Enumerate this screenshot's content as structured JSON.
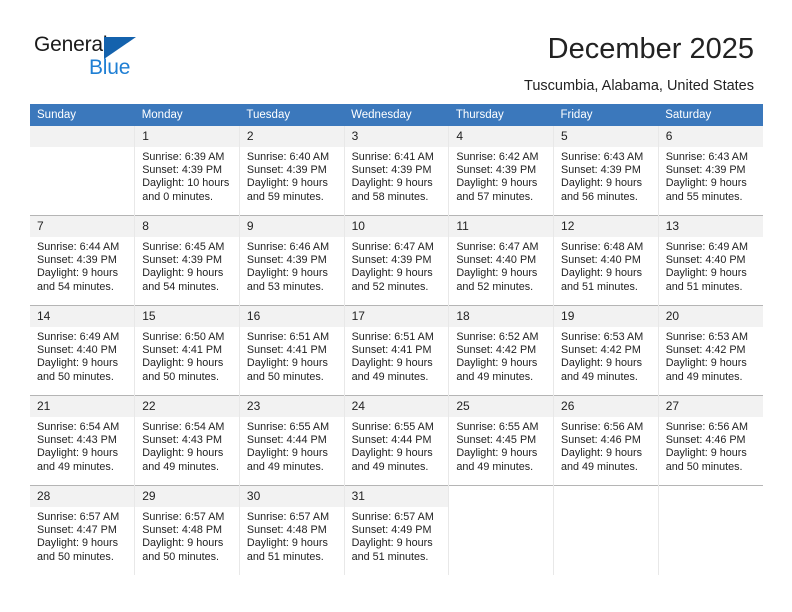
{
  "brand": {
    "name_part1": "General",
    "name_part2": "Blue",
    "accent_color": "#1f7fd4",
    "triangle_color": "#1462ad"
  },
  "header": {
    "title": "December 2025",
    "subtitle": "Tuscumbia, Alabama, United States"
  },
  "calendar": {
    "header_bg": "#3b78bc",
    "daynum_bg": "#f2f2f2",
    "weekdays": [
      "Sunday",
      "Monday",
      "Tuesday",
      "Wednesday",
      "Thursday",
      "Friday",
      "Saturday"
    ],
    "weeks": [
      [
        {
          "day": "",
          "empty": true,
          "line1": "",
          "line2": "",
          "line3": "",
          "line4": ""
        },
        {
          "day": "1",
          "line1": "Sunrise: 6:39 AM",
          "line2": "Sunset: 4:39 PM",
          "line3": "Daylight: 10 hours",
          "line4": "and 0 minutes."
        },
        {
          "day": "2",
          "line1": "Sunrise: 6:40 AM",
          "line2": "Sunset: 4:39 PM",
          "line3": "Daylight: 9 hours",
          "line4": "and 59 minutes."
        },
        {
          "day": "3",
          "line1": "Sunrise: 6:41 AM",
          "line2": "Sunset: 4:39 PM",
          "line3": "Daylight: 9 hours",
          "line4": "and 58 minutes."
        },
        {
          "day": "4",
          "line1": "Sunrise: 6:42 AM",
          "line2": "Sunset: 4:39 PM",
          "line3": "Daylight: 9 hours",
          "line4": "and 57 minutes."
        },
        {
          "day": "5",
          "line1": "Sunrise: 6:43 AM",
          "line2": "Sunset: 4:39 PM",
          "line3": "Daylight: 9 hours",
          "line4": "and 56 minutes."
        },
        {
          "day": "6",
          "line1": "Sunrise: 6:43 AM",
          "line2": "Sunset: 4:39 PM",
          "line3": "Daylight: 9 hours",
          "line4": "and 55 minutes."
        }
      ],
      [
        {
          "day": "7",
          "line1": "Sunrise: 6:44 AM",
          "line2": "Sunset: 4:39 PM",
          "line3": "Daylight: 9 hours",
          "line4": "and 54 minutes."
        },
        {
          "day": "8",
          "line1": "Sunrise: 6:45 AM",
          "line2": "Sunset: 4:39 PM",
          "line3": "Daylight: 9 hours",
          "line4": "and 54 minutes."
        },
        {
          "day": "9",
          "line1": "Sunrise: 6:46 AM",
          "line2": "Sunset: 4:39 PM",
          "line3": "Daylight: 9 hours",
          "line4": "and 53 minutes."
        },
        {
          "day": "10",
          "line1": "Sunrise: 6:47 AM",
          "line2": "Sunset: 4:39 PM",
          "line3": "Daylight: 9 hours",
          "line4": "and 52 minutes."
        },
        {
          "day": "11",
          "line1": "Sunrise: 6:47 AM",
          "line2": "Sunset: 4:40 PM",
          "line3": "Daylight: 9 hours",
          "line4": "and 52 minutes."
        },
        {
          "day": "12",
          "line1": "Sunrise: 6:48 AM",
          "line2": "Sunset: 4:40 PM",
          "line3": "Daylight: 9 hours",
          "line4": "and 51 minutes."
        },
        {
          "day": "13",
          "line1": "Sunrise: 6:49 AM",
          "line2": "Sunset: 4:40 PM",
          "line3": "Daylight: 9 hours",
          "line4": "and 51 minutes."
        }
      ],
      [
        {
          "day": "14",
          "line1": "Sunrise: 6:49 AM",
          "line2": "Sunset: 4:40 PM",
          "line3": "Daylight: 9 hours",
          "line4": "and 50 minutes."
        },
        {
          "day": "15",
          "line1": "Sunrise: 6:50 AM",
          "line2": "Sunset: 4:41 PM",
          "line3": "Daylight: 9 hours",
          "line4": "and 50 minutes."
        },
        {
          "day": "16",
          "line1": "Sunrise: 6:51 AM",
          "line2": "Sunset: 4:41 PM",
          "line3": "Daylight: 9 hours",
          "line4": "and 50 minutes."
        },
        {
          "day": "17",
          "line1": "Sunrise: 6:51 AM",
          "line2": "Sunset: 4:41 PM",
          "line3": "Daylight: 9 hours",
          "line4": "and 49 minutes."
        },
        {
          "day": "18",
          "line1": "Sunrise: 6:52 AM",
          "line2": "Sunset: 4:42 PM",
          "line3": "Daylight: 9 hours",
          "line4": "and 49 minutes."
        },
        {
          "day": "19",
          "line1": "Sunrise: 6:53 AM",
          "line2": "Sunset: 4:42 PM",
          "line3": "Daylight: 9 hours",
          "line4": "and 49 minutes."
        },
        {
          "day": "20",
          "line1": "Sunrise: 6:53 AM",
          "line2": "Sunset: 4:42 PM",
          "line3": "Daylight: 9 hours",
          "line4": "and 49 minutes."
        }
      ],
      [
        {
          "day": "21",
          "line1": "Sunrise: 6:54 AM",
          "line2": "Sunset: 4:43 PM",
          "line3": "Daylight: 9 hours",
          "line4": "and 49 minutes."
        },
        {
          "day": "22",
          "line1": "Sunrise: 6:54 AM",
          "line2": "Sunset: 4:43 PM",
          "line3": "Daylight: 9 hours",
          "line4": "and 49 minutes."
        },
        {
          "day": "23",
          "line1": "Sunrise: 6:55 AM",
          "line2": "Sunset: 4:44 PM",
          "line3": "Daylight: 9 hours",
          "line4": "and 49 minutes."
        },
        {
          "day": "24",
          "line1": "Sunrise: 6:55 AM",
          "line2": "Sunset: 4:44 PM",
          "line3": "Daylight: 9 hours",
          "line4": "and 49 minutes."
        },
        {
          "day": "25",
          "line1": "Sunrise: 6:55 AM",
          "line2": "Sunset: 4:45 PM",
          "line3": "Daylight: 9 hours",
          "line4": "and 49 minutes."
        },
        {
          "day": "26",
          "line1": "Sunrise: 6:56 AM",
          "line2": "Sunset: 4:46 PM",
          "line3": "Daylight: 9 hours",
          "line4": "and 49 minutes."
        },
        {
          "day": "27",
          "line1": "Sunrise: 6:56 AM",
          "line2": "Sunset: 4:46 PM",
          "line3": "Daylight: 9 hours",
          "line4": "and 50 minutes."
        }
      ],
      [
        {
          "day": "28",
          "line1": "Sunrise: 6:57 AM",
          "line2": "Sunset: 4:47 PM",
          "line3": "Daylight: 9 hours",
          "line4": "and 50 minutes."
        },
        {
          "day": "29",
          "line1": "Sunrise: 6:57 AM",
          "line2": "Sunset: 4:48 PM",
          "line3": "Daylight: 9 hours",
          "line4": "and 50 minutes."
        },
        {
          "day": "30",
          "line1": "Sunrise: 6:57 AM",
          "line2": "Sunset: 4:48 PM",
          "line3": "Daylight: 9 hours",
          "line4": "and 51 minutes."
        },
        {
          "day": "31",
          "line1": "Sunrise: 6:57 AM",
          "line2": "Sunset: 4:49 PM",
          "line3": "Daylight: 9 hours",
          "line4": "and 51 minutes."
        },
        {
          "day": "",
          "empty": true,
          "blank": true,
          "line1": "",
          "line2": "",
          "line3": "",
          "line4": ""
        },
        {
          "day": "",
          "empty": true,
          "blank": true,
          "line1": "",
          "line2": "",
          "line3": "",
          "line4": ""
        },
        {
          "day": "",
          "empty": true,
          "blank": true,
          "line1": "",
          "line2": "",
          "line3": "",
          "line4": ""
        }
      ]
    ]
  }
}
